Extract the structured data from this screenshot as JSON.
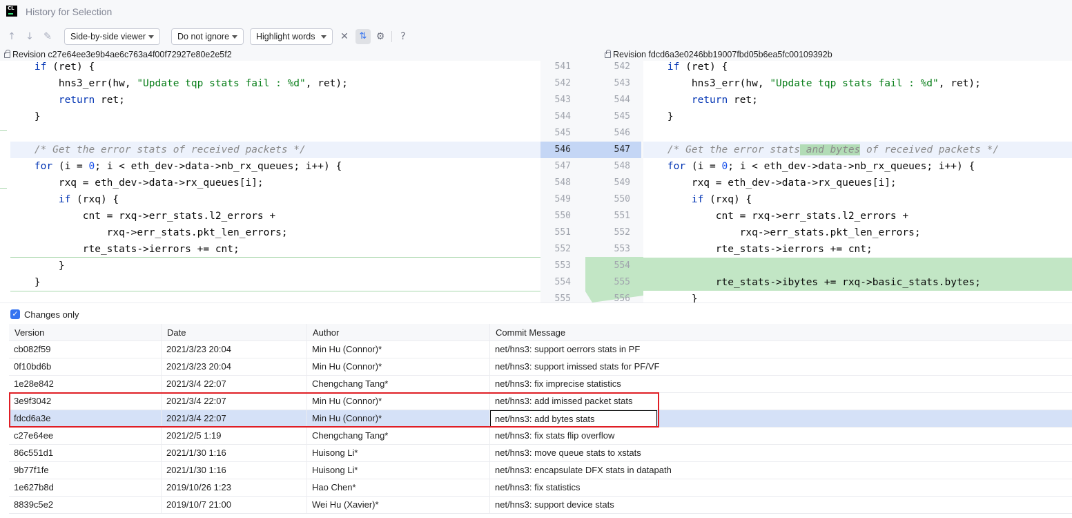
{
  "window": {
    "title": "History for Selection"
  },
  "toolbar": {
    "prev_icon": "arrow-up-icon",
    "next_icon": "arrow-down-icon",
    "edit_icon": "pencil-icon",
    "viewer_mode": "Side-by-side viewer",
    "ignore_mode": "Do not ignore",
    "highlight_mode": "Highlight words",
    "collapse_icon": "collapse-icon",
    "sync_scroll_icon": "sync-scroll-icon",
    "settings_icon": "gear-icon",
    "help_icon": "question-icon"
  },
  "diff": {
    "left_revision": "Revision c27e64ee3e9b4ae6c763a4f00f72927e80e2e5f2",
    "right_revision": "Revision fdcd6a3e0246bb19007fbd05b6ea5fc00109392b",
    "left_line_numbers": [
      "541",
      "542",
      "543",
      "544",
      "545",
      "546",
      "547",
      "548",
      "549",
      "550",
      "551",
      "552",
      "553",
      "554",
      "555"
    ],
    "right_line_numbers": [
      "542",
      "543",
      "544",
      "545",
      "546",
      "547",
      "548",
      "549",
      "550",
      "551",
      "552",
      "553",
      "554",
      "555",
      "556"
    ],
    "left_code": {
      "l0": {
        "kw": "if",
        "rest": " (ret) {"
      },
      "l1": {
        "pre": "    hns3_err(hw, ",
        "str": "\"Update tqp stats fail : %d\"",
        "post": ", ret);"
      },
      "l2": {
        "kw": "return",
        "rest": " ret;"
      },
      "l3": "}",
      "l5": "/* Get the error stats of received packets */",
      "l6": {
        "kw": "for",
        "a": " (i = ",
        "num": "0",
        "b": "; i < eth_dev->data->nb_rx_queues; i++) {"
      },
      "l7": "    rxq = eth_dev->data->rx_queues[i];",
      "l8": {
        "kw": "if",
        "rest": " (rxq) {"
      },
      "l9": "        cnt = rxq->err_stats.l2_errors +",
      "l10": "            rxq->err_stats.pkt_len_errors;",
      "l11": "        rte_stats->ierrors += cnt;",
      "l12": "    }",
      "l13": "}"
    },
    "right_code": {
      "l0": {
        "kw": "if",
        "rest": " (ret) {"
      },
      "l1": {
        "pre": "    hns3_err(hw, ",
        "str": "\"Update tqp stats fail : %d\"",
        "post": ", ret);"
      },
      "l2": {
        "kw": "return",
        "rest": " ret;"
      },
      "l3": "}",
      "l5a": "/* Get the error stats",
      "l5b": " and bytes",
      "l5c": " of received packets */",
      "l6": {
        "kw": "for",
        "a": " (i = ",
        "num": "0",
        "b": "; i < eth_dev->data->nb_rx_queues; i++) {"
      },
      "l7": "    rxq = eth_dev->data->rx_queues[i];",
      "l8": {
        "kw": "if",
        "rest": " (rxq) {"
      },
      "l9": "        cnt = rxq->err_stats.l2_errors +",
      "l10": "            rxq->err_stats.pkt_len_errors;",
      "l11": "        rte_stats->ierrors += cnt;",
      "l13": "        rte_stats->ibytes += rxq->basic_stats.bytes;",
      "l14": "    }"
    }
  },
  "history": {
    "changes_only_label": "Changes only",
    "changes_only_checked": true,
    "columns": [
      "Version",
      "Date",
      "Author",
      "Commit Message"
    ],
    "rows": [
      {
        "version": "cb082f59",
        "date": "2021/3/23 20:04",
        "author": "Min Hu (Connor)*",
        "message": "net/hns3: support oerrors stats in PF"
      },
      {
        "version": "0f10bd6b",
        "date": "2021/3/23 20:04",
        "author": "Min Hu (Connor)*",
        "message": "net/hns3: support imissed stats for PF/VF"
      },
      {
        "version": "1e28e842",
        "date": "2021/3/4 22:07",
        "author": "Chengchang Tang*",
        "message": "net/hns3: fix imprecise statistics"
      },
      {
        "version": "3e9f3042",
        "date": "2021/3/4 22:07",
        "author": "Min Hu (Connor)*",
        "message": "net/hns3: add imissed packet stats"
      },
      {
        "version": "fdcd6a3e",
        "date": "2021/3/4 22:07",
        "author": "Min Hu (Connor)*",
        "message": "net/hns3: add bytes stats"
      },
      {
        "version": "c27e64ee",
        "date": "2021/2/5 1:19",
        "author": "Chengchang Tang*",
        "message": "net/hns3: fix stats flip overflow"
      },
      {
        "version": "86c551d1",
        "date": "2021/1/30 1:16",
        "author": "Huisong Li*",
        "message": "net/hns3: move queue stats to xstats"
      },
      {
        "version": "9b77f1fe",
        "date": "2021/1/30 1:16",
        "author": "Huisong Li*",
        "message": "net/hns3: encapsulate DFX stats in datapath"
      },
      {
        "version": "1e627b8d",
        "date": "2019/10/26 1:23",
        "author": "Hao Chen*",
        "message": "net/hns3: fix statistics"
      },
      {
        "version": "8839c5e2",
        "date": "2019/10/7 21:00",
        "author": "Wei Hu (Xavier)*",
        "message": "net/hns3: support device stats"
      }
    ],
    "selected_row": "fdcd6a3e"
  },
  "colors": {
    "added_background": "#c2e6c5",
    "selection": "#d5e1f7",
    "annotation_frame": "#e01e25",
    "accent": "#3574f0"
  }
}
